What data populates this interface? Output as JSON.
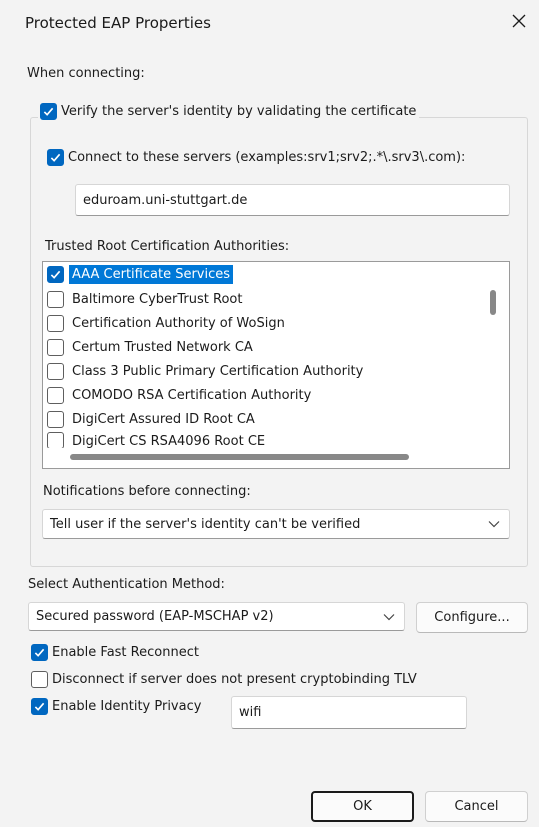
{
  "window": {
    "title": "Protected EAP Properties"
  },
  "when_connecting_label": "When connecting:",
  "verify": {
    "checked": true,
    "label": "Verify the server's identity by validating the certificate"
  },
  "connect_servers": {
    "checked": true,
    "label": "Connect to these servers (examples:srv1;srv2;.*\\.srv3\\.com):",
    "value": "eduroam.uni-stuttgart.de"
  },
  "trusted_root": {
    "label": "Trusted Root Certification Authorities:",
    "items": [
      {
        "label": "AAA Certificate Services",
        "checked": true,
        "selected": true
      },
      {
        "label": "Baltimore CyberTrust Root",
        "checked": false,
        "selected": false
      },
      {
        "label": "Certification Authority of WoSign",
        "checked": false,
        "selected": false
      },
      {
        "label": "Certum Trusted Network CA",
        "checked": false,
        "selected": false
      },
      {
        "label": "Class 3 Public Primary Certification Authority",
        "checked": false,
        "selected": false
      },
      {
        "label": "COMODO RSA Certification Authority",
        "checked": false,
        "selected": false
      },
      {
        "label": "DigiCert Assured ID Root CA",
        "checked": false,
        "selected": false
      },
      {
        "label": "DigiCert CS RSA4096 Root CE",
        "checked": false,
        "selected": false
      }
    ]
  },
  "notifications": {
    "label": "Notifications before connecting:",
    "selected": "Tell user if the server's identity can't be verified"
  },
  "auth_method": {
    "label": "Select Authentication Method:",
    "selected": "Secured password (EAP-MSCHAP v2)",
    "configure_label": "Configure..."
  },
  "fast_reconnect": {
    "checked": true,
    "label": "Enable Fast Reconnect"
  },
  "cryptobinding": {
    "checked": false,
    "label": "Disconnect if server does not present cryptobinding TLV"
  },
  "identity_privacy": {
    "checked": true,
    "label": "Enable Identity Privacy",
    "value": "wifi"
  },
  "buttons": {
    "ok": "OK",
    "cancel": "Cancel"
  },
  "colors": {
    "accent": "#0067c0",
    "selection": "#0078d7",
    "background": "#f3f3f3"
  }
}
